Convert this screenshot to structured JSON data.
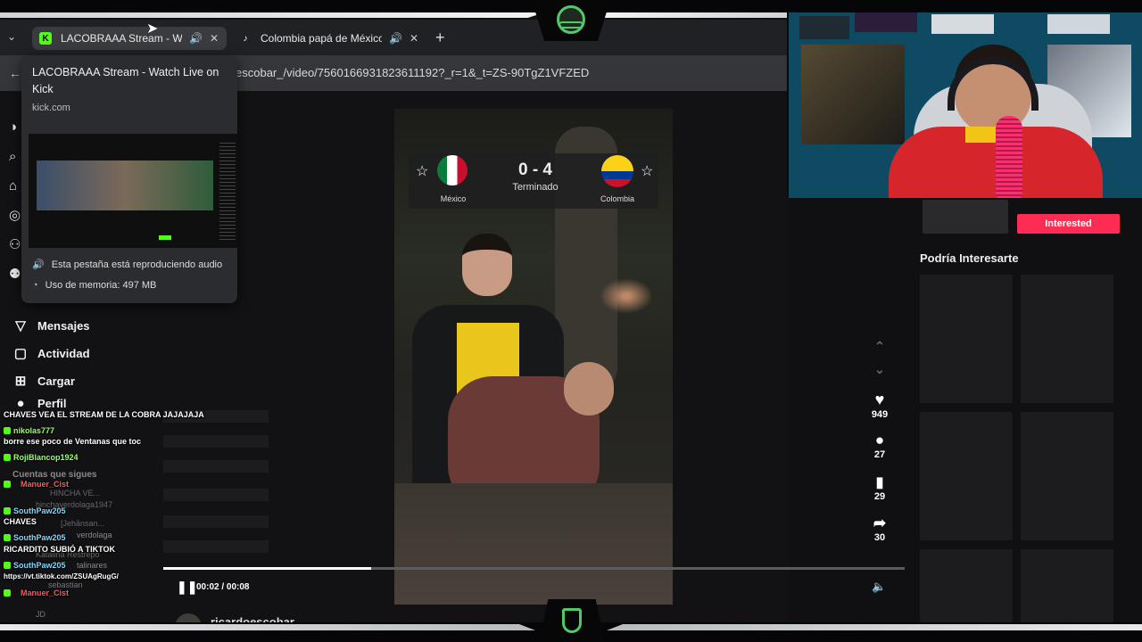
{
  "browser": {
    "tabs": [
      {
        "title": "LACOBRAAA Stream - Watch",
        "favicon": "kick-icon",
        "active": true
      },
      {
        "title": "Colombia papá de México,",
        "favicon": "tiktok-icon",
        "active": false
      }
    ],
    "url": "escobar_/video/7560166931823611192?_r=1&_t=ZS-90TgZ1VFZED"
  },
  "hover_card": {
    "title": "LACOBRAAA Stream - Watch Live on Kick",
    "domain": "kick.com",
    "audio_status": "Esta pestaña está reproduciendo audio",
    "memory": "Uso de memoria: 497 MB"
  },
  "sidebar": {
    "items": [
      {
        "label": "Mensajes",
        "icon": "send-icon"
      },
      {
        "label": "Actividad",
        "icon": "inbox-icon"
      },
      {
        "label": "Cargar",
        "icon": "upload-icon"
      },
      {
        "label": "Perfil",
        "icon": "profile-icon"
      }
    ],
    "following_title": "Cuentas que sigues",
    "accounts": [
      "HINCHA VE...",
      "hinchaverdolaga1947",
      "[Jehānsan...",
      "verdolaga",
      "Katalina Restrepo",
      "talinares",
      "sebastian",
      "JD"
    ]
  },
  "video": {
    "match": {
      "home_team": "México",
      "away_team": "Colombia",
      "score": "0 - 4",
      "status": "Terminado"
    },
    "time": "00:02 / 00:08",
    "progress": 0.28,
    "author": "ricardoescobar",
    "actions": [
      {
        "icon": "heart-icon",
        "count": "949"
      },
      {
        "icon": "comment-icon",
        "count": "27"
      },
      {
        "icon": "bookmark-icon",
        "count": "29"
      },
      {
        "icon": "share-icon",
        "count": "30"
      }
    ]
  },
  "right": {
    "interested_label": "Interested",
    "section_title": "Podría Interesarte"
  },
  "chat": [
    {
      "user": "",
      "text": "CHAVES VEA EL STREAM DE LA COBRA JAJAJAJA"
    },
    {
      "user": "nikolas777",
      "text": ""
    },
    {
      "user": "",
      "text": "borre ese poco de Ventanas que toc"
    },
    {
      "user": "RojiBlancop1924",
      "text": ""
    },
    {
      "user": "Manuer_Cist",
      "text": ""
    },
    {
      "user": "SouthPaw205",
      "text": ""
    },
    {
      "user": "",
      "text": "CHAVES"
    },
    {
      "user": "SouthPaw205",
      "text": ""
    },
    {
      "user": "",
      "text": "RICARDITO SUBIÓ A TIKTOK"
    },
    {
      "user": "SouthPaw205",
      "text": ""
    },
    {
      "user": "",
      "text": "https://vt.tiktok.com/ZSUAgRugG/"
    },
    {
      "user": "Manuer_Cist",
      "text": ""
    }
  ],
  "colors": {
    "kick_green": "#53fc18",
    "interested_red": "#fe2c55",
    "tiktok_bg": "#121214"
  }
}
